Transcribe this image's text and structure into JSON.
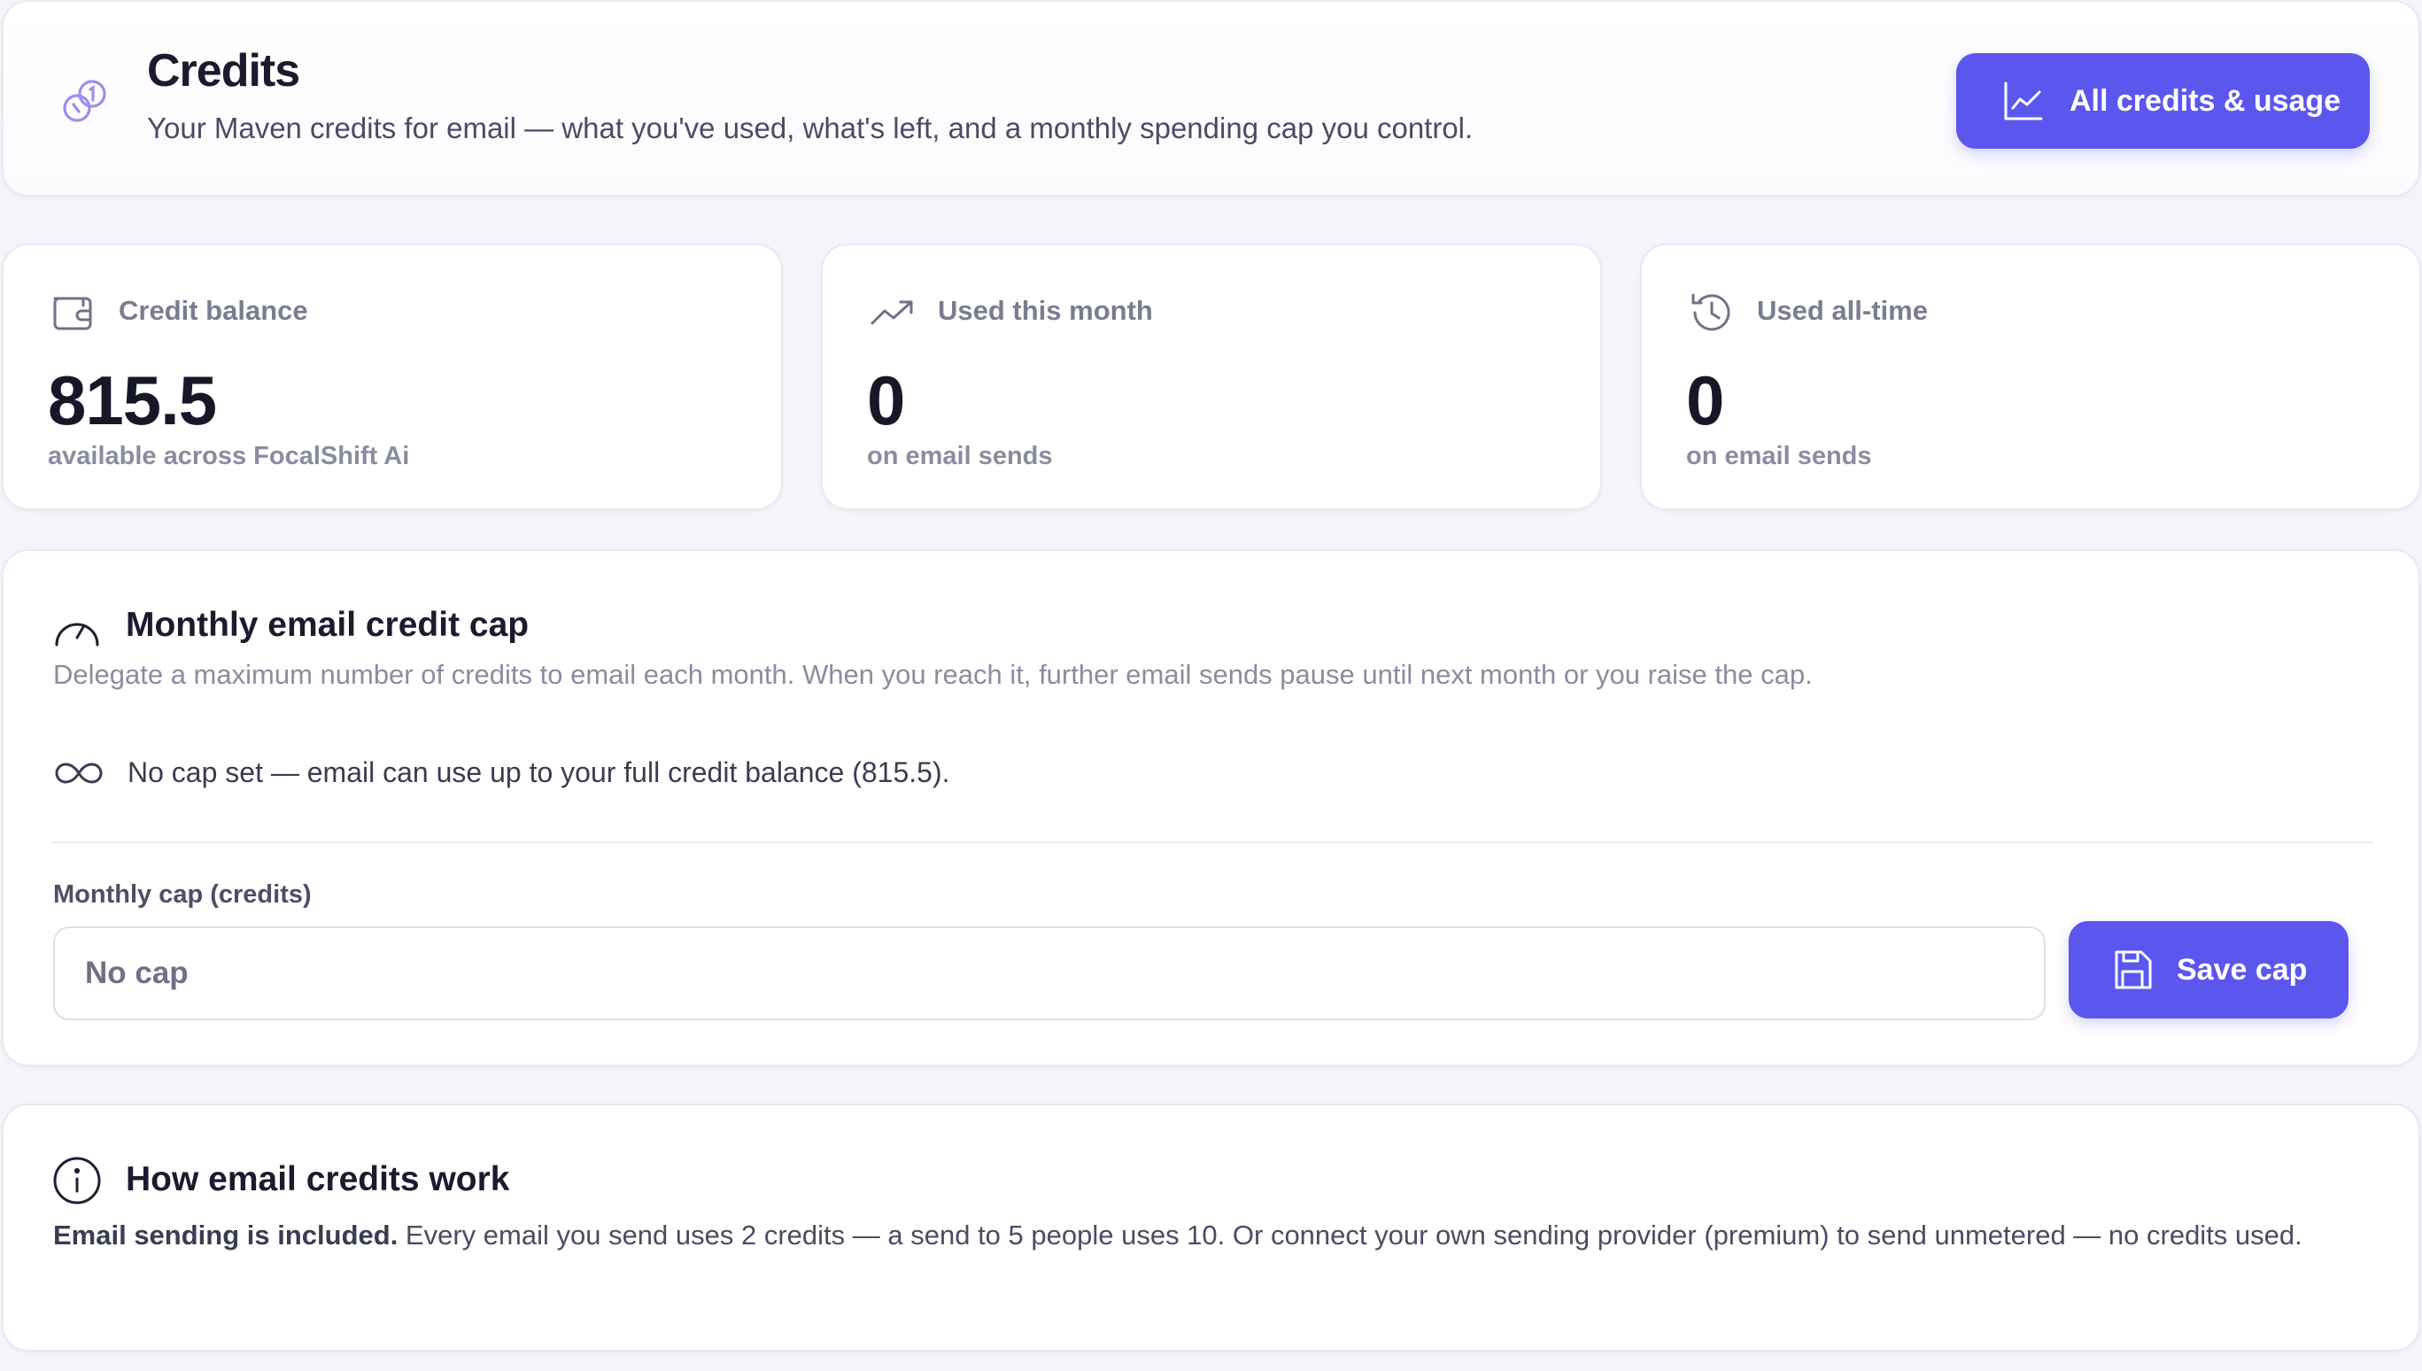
{
  "header": {
    "title": "Credits",
    "subtitle": "Your Maven credits for email — what you've used, what's left, and a monthly spending cap you control.",
    "icon": "coins-icon",
    "button_label": "All credits & usage",
    "button_icon": "line-chart-icon"
  },
  "stats": {
    "balance": {
      "label": "Credit balance",
      "value": "815.5",
      "note": "available across FocalShift Ai",
      "icon": "wallet-icon"
    },
    "month": {
      "label": "Used this month",
      "value": "0",
      "note": "on email sends",
      "icon": "trending-up-icon"
    },
    "alltime": {
      "label": "Used all-time",
      "value": "0",
      "note": "on email sends",
      "icon": "history-icon"
    }
  },
  "cap": {
    "title": "Monthly email credit cap",
    "icon": "gauge-icon",
    "description": "Delegate a maximum number of credits to email each month. When you reach it, further email sends pause until next month or you raise the cap.",
    "status_text": "No cap set — email can use up to your full credit balance (815.5).",
    "status_icon": "infinity-icon",
    "field_label": "Monthly cap (credits)",
    "input_placeholder": "No cap",
    "save_label": "Save cap",
    "save_icon": "save-icon"
  },
  "how": {
    "title": "How email credits work",
    "icon": "info-icon",
    "lead": "Email sending is included.",
    "body": " Every email you send uses 2 credits — a send to 5 people uses 10. Or connect your own sending provider (premium) to send unmetered — no credits used."
  },
  "colors": {
    "accent": "#5b57ee",
    "background": "#f4f5fa",
    "muted_text": "#8a8ca0"
  }
}
